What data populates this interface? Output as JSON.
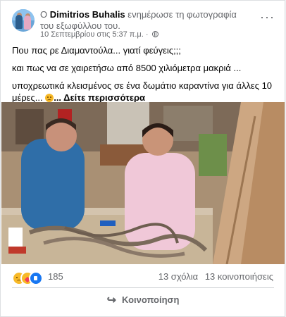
{
  "post": {
    "author": "Dimitrios Buhalis",
    "action_prefix": "Ο",
    "action_suffix": "ενημέρωσε τη φωτογραφία του εξωφύλλου του.",
    "timestamp": "10 Σεπτεμβρίου στις 5:37 π.μ.",
    "audience_icon": "globe-icon",
    "menu_icon": "more-options-icon",
    "text_lines": [
      "Που πας ρε Διαμαντούλα... γιατί φεύγεις;;;",
      "και πως να σε χαιρετήσω από 8500 χιλιόμετρα μακριά ...",
      "υποχρεωτικά κλεισμένος σε ένα δωμάτιο καραντίνα για άλλες 10 μέρες..."
    ],
    "see_more": "... Δείτε περισσότερα"
  },
  "footer": {
    "reaction_icons": [
      "sad-icon",
      "care-icon",
      "like-icon"
    ],
    "reaction_count": "185",
    "comments": "13 σχόλια",
    "shares": "13 κοινοποιήσεις",
    "share_label": "Κοινοποίηση",
    "share_icon": "share-arrow-icon"
  },
  "colors": {
    "text_primary": "#050505",
    "text_secondary": "#65676b",
    "like_blue": "#1877f2",
    "divider": "#ced0d4"
  }
}
